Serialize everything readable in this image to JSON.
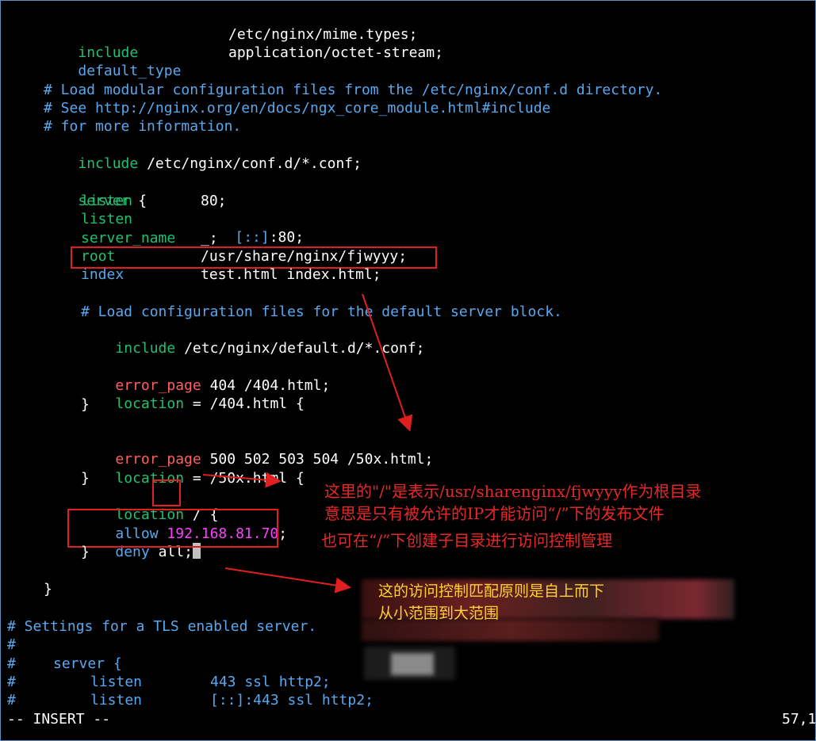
{
  "editor": {
    "lines": [
      {
        "k": "include",
        "v": "/etc/nginx/mime.types;"
      },
      {
        "k": "default_type",
        "v": "application/octet-stream;"
      },
      {
        "comment1": "# Load modular configuration files from the /etc/nginx/conf.d directory."
      },
      {
        "comment2": "# See http://nginx.org/en/docs/ngx_core_module.html#include"
      },
      {
        "comment3": "# for more information."
      },
      {
        "k": "include",
        "v": "/etc/nginx/conf.d/*.conf;"
      },
      {
        "server_open": "server {"
      },
      {
        "k": "listen",
        "v": "80;"
      },
      {
        "k": "listen",
        "v6": "[::]",
        "v": ":80;"
      },
      {
        "k": "server_name",
        "v": "_;"
      },
      {
        "k": "root",
        "v": "/usr/share/nginx/fjwyyy;"
      },
      {
        "k": "index",
        "v": "test.html index.html;"
      },
      {
        "comment4": "# Load configuration files for the default server block."
      },
      {
        "k": "include",
        "v": "/etc/nginx/default.d/*.conf;"
      },
      {
        "k": "error_page",
        "v": "404 /404.html;"
      },
      {
        "k": "location",
        "v": "= /404.html {"
      },
      {
        "brace": "}"
      },
      {
        "k": "error_page",
        "v": "500 502 503 504 /50x.html;"
      },
      {
        "k": "location",
        "v": "= /50x.html {"
      },
      {
        "brace": "}"
      },
      {
        "k": "location",
        "v": "/ {"
      },
      {
        "k": "allow",
        "ip": "192.168.81.70",
        "v": ";"
      },
      {
        "k": "deny",
        "v": "all;"
      },
      {
        "brace": "}"
      },
      {
        "brace": "}"
      },
      {
        "comment5": "# Settings for a TLS enabled server."
      },
      {
        "hash": "#"
      },
      {
        "c_server": "#    server {"
      },
      {
        "c_listen1_k": "listen",
        "c_listen1_v": "443 ssl http2;"
      },
      {
        "c_listen2_k": "listen",
        "c_listen2_v": "[::]:443 ssl http2;"
      }
    ]
  },
  "text": {
    "l1k": "include",
    "l1v": "/etc/nginx/mime.types;",
    "l2k": "default_type",
    "l2v": "application/octet-stream;",
    "c1": "# Load modular configuration files from the /etc/nginx/conf.d directory.",
    "c2": "# See http://nginx.org/en/docs/ngx_core_module.html#include",
    "c3": "# for more information.",
    "l3k": "include",
    "l3v": "/etc/nginx/conf.d/*.conf;",
    "server_kw": "server",
    "brace_open": " {",
    "listen_kw": "listen",
    "listen1_v": "80;",
    "listen2_v6": "[::]",
    "listen2_v": ":80;",
    "server_name_kw": "server_name",
    "server_name_v": "_;",
    "root_kw": "root",
    "root_v": "/usr/share/nginx/fjwyyy;",
    "index_kw": "index",
    "index_v": "test.html index.html;",
    "c4": "# Load configuration files for the default server block.",
    "include_kw": "include",
    "include2_v": "/etc/nginx/default.d/*.conf;",
    "error_page_kw": "error_page",
    "ep1_v": "404 /404.html;",
    "location_kw": "location",
    "loc1_v": "= /404.html {",
    "close_brace": "}",
    "ep2_v": "500 502 503 504 /50x.html;",
    "loc2_v": "= /50x.html {",
    "loc3_v": "/ {",
    "allow_kw": "allow",
    "allow_ip": "192.168.81.70",
    "allow_semicolon": ";",
    "deny_kw": "deny",
    "deny_v": "all;",
    "c5": "# Settings for a TLS enabled server.",
    "hash": "#",
    "c_server_hash": "#",
    "c_server": "server {",
    "c_listen_hash": "#",
    "c_listen_kw": "listen",
    "c_listen1_v": "443 ssl http2;",
    "c_listen2_v": "[::]:443 ssl http2;"
  },
  "annotations": {
    "note1_line1": "这里的\"/\"是表示/usr/sharenginx/fjwyyy作为根目录",
    "note1_line2": "意思是只有被允许的IP才能访问“/”下的发布文件",
    "note1_line3": "也可在“/”下创建子目录进行访问控制管理",
    "note2_line1": "这的访问控制匹配原则是自上而下",
    "note2_line2": "从小范围到大范围"
  },
  "status": {
    "mode": "-- INSERT --",
    "position": "57,1"
  },
  "colors": {
    "background": "#000000",
    "keyword_green": "#20c070",
    "keyword_blue": "#58a8f0",
    "keyword_red": "#ff5f5f",
    "ip_magenta": "#ff40ff",
    "annotation_red": "#e82828",
    "annotation_yellow": "#ffd030"
  }
}
